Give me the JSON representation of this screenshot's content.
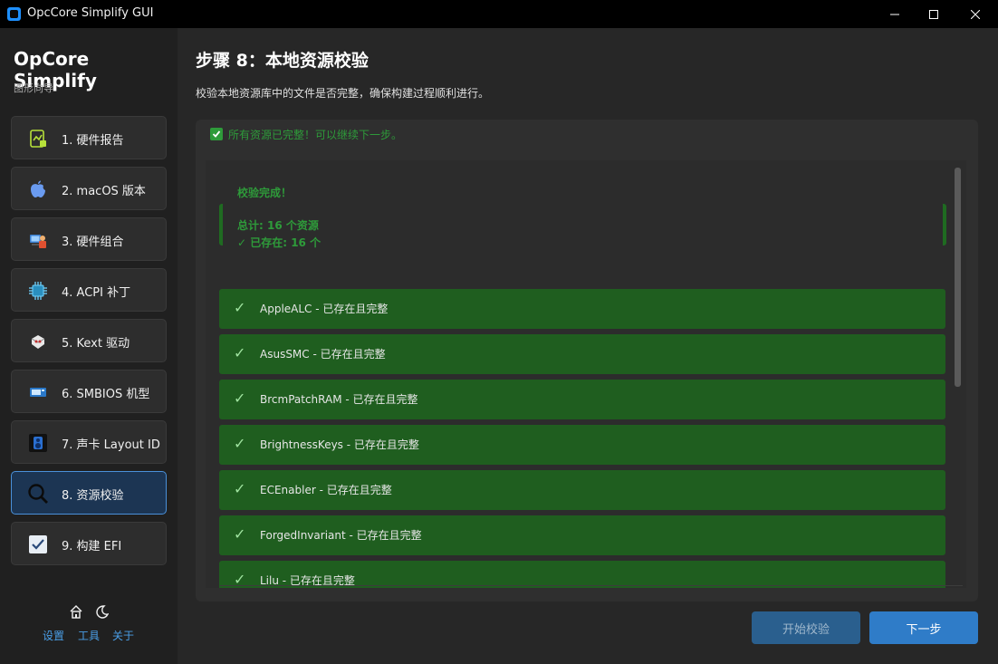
{
  "window": {
    "title": "OpcCore Simplify GUI"
  },
  "sidebar": {
    "brand": "OpCore Simplify",
    "subtitle": "图形向导",
    "items": [
      {
        "label": "1. 硬件报告",
        "icon": "report-icon"
      },
      {
        "label": "2. macOS 版本",
        "icon": "apple-icon"
      },
      {
        "label": "3. 硬件组合",
        "icon": "hardware-icon"
      },
      {
        "label": "4. ACPI 补丁",
        "icon": "chip-icon"
      },
      {
        "label": "5. Kext 驱动",
        "icon": "kext-icon"
      },
      {
        "label": "6. SMBIOS 机型",
        "icon": "computer-icon"
      },
      {
        "label": "7. 声卡 Layout ID",
        "icon": "speaker-icon"
      },
      {
        "label": "8. 资源校验",
        "icon": "magnifier-icon",
        "active": true
      },
      {
        "label": "9. 构建 EFI",
        "icon": "checkbox-icon"
      }
    ],
    "footer": {
      "settings": "设置",
      "tools": "工具",
      "about": "关于"
    }
  },
  "main": {
    "title": "步骤 8：本地资源校验",
    "description": "校验本地资源库中的文件是否完整，确保构建过程顺利进行。",
    "status": "所有资源已完整！可以继续下一步。",
    "summary": {
      "title": "校验完成！",
      "total": "总计: 16 个资源",
      "present": "✓ 已存在: 16 个"
    },
    "results": [
      "AppleALC - 已存在且完整",
      "AsusSMC - 已存在且完整",
      "BrcmPatchRAM - 已存在且完整",
      "BrightnessKeys - 已存在且完整",
      "ECEnabler - 已存在且完整",
      "ForgedInvariant - 已存在且完整",
      "Lilu - 已存在且完整"
    ],
    "buttons": {
      "start": "开始校验",
      "next": "下一步"
    }
  },
  "colors": {
    "accent": "#2f7cc8",
    "success": "#2e9b3a",
    "success_bg": "#1f5e1f"
  }
}
